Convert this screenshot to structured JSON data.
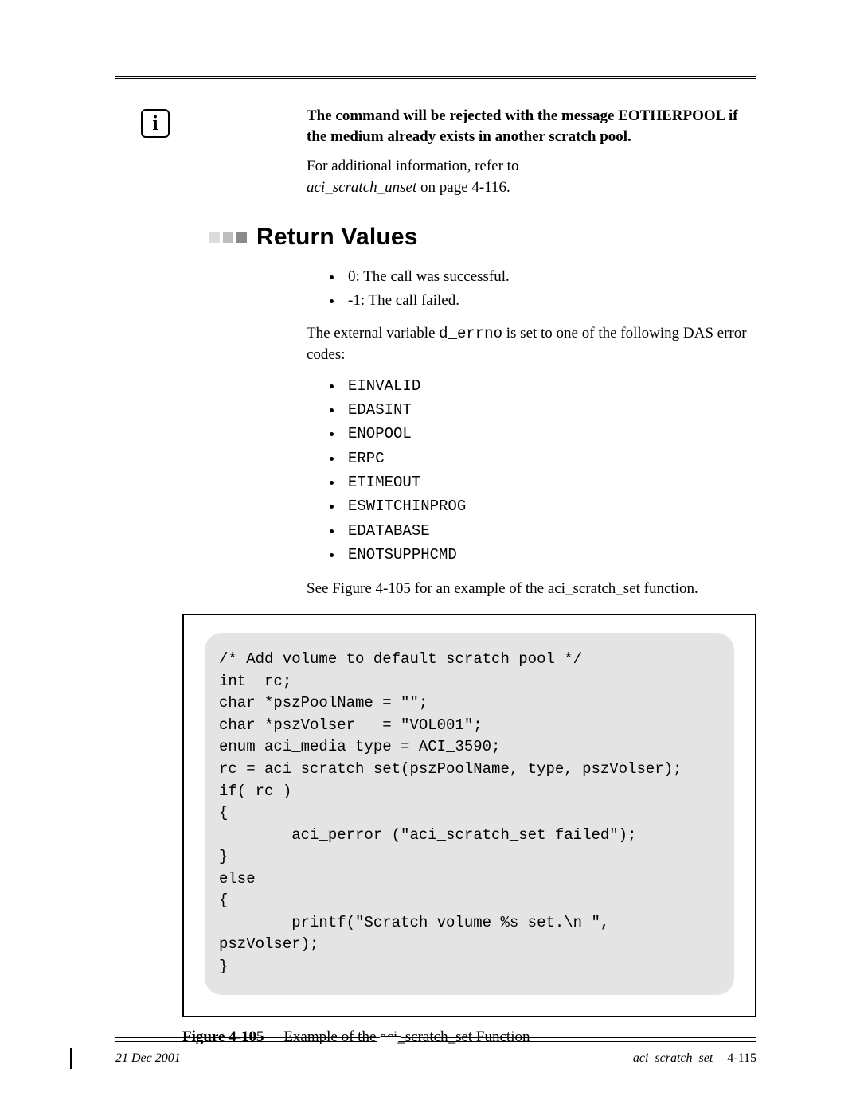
{
  "note": {
    "warn_text": "The command will be rejected with the message EOTHERPOOL if the medium already exists in another scratch pool.",
    "addl_line": "For additional information, refer to",
    "xref_text": "aci_scratch_unset",
    "xref_tail": "  on page 4-116."
  },
  "section": {
    "title": "Return Values"
  },
  "returns": {
    "items": [
      "0: The call was successful.",
      "-1: The call failed."
    ],
    "errno_sentence_pre": "The external variable ",
    "errno_var": "d_errno",
    "errno_sentence_post": " is set to one of the following DAS error codes:",
    "codes": [
      "EINVALID",
      "EDASINT",
      "ENOPOOL",
      "ERPC",
      "ETIMEOUT",
      "ESWITCHINPROG",
      "EDATABASE",
      "ENOTSUPPHCMD"
    ],
    "see_fig": "See Figure 4-105 for an example of the aci_scratch_set function."
  },
  "figure": {
    "code": "/* Add volume to default scratch pool */\nint  rc;\nchar *pszPoolName = \"\";\nchar *pszVolser   = \"VOL001\";\nenum aci_media type = ACI_3590;\nrc = aci_scratch_set(pszPoolName, type, pszVolser);\nif( rc )\n{\n        aci_perror (\"aci_scratch_set failed\");\n}\nelse\n{\n        printf(\"Scratch volume %s set.\\n \",\npszVolser);\n}",
    "label": "Figure 4-105",
    "caption": "Example of the aci_scratch_set Function"
  },
  "footer": {
    "date": "21 Dec 2001",
    "title": "aci_scratch_set",
    "page": "4-115"
  }
}
